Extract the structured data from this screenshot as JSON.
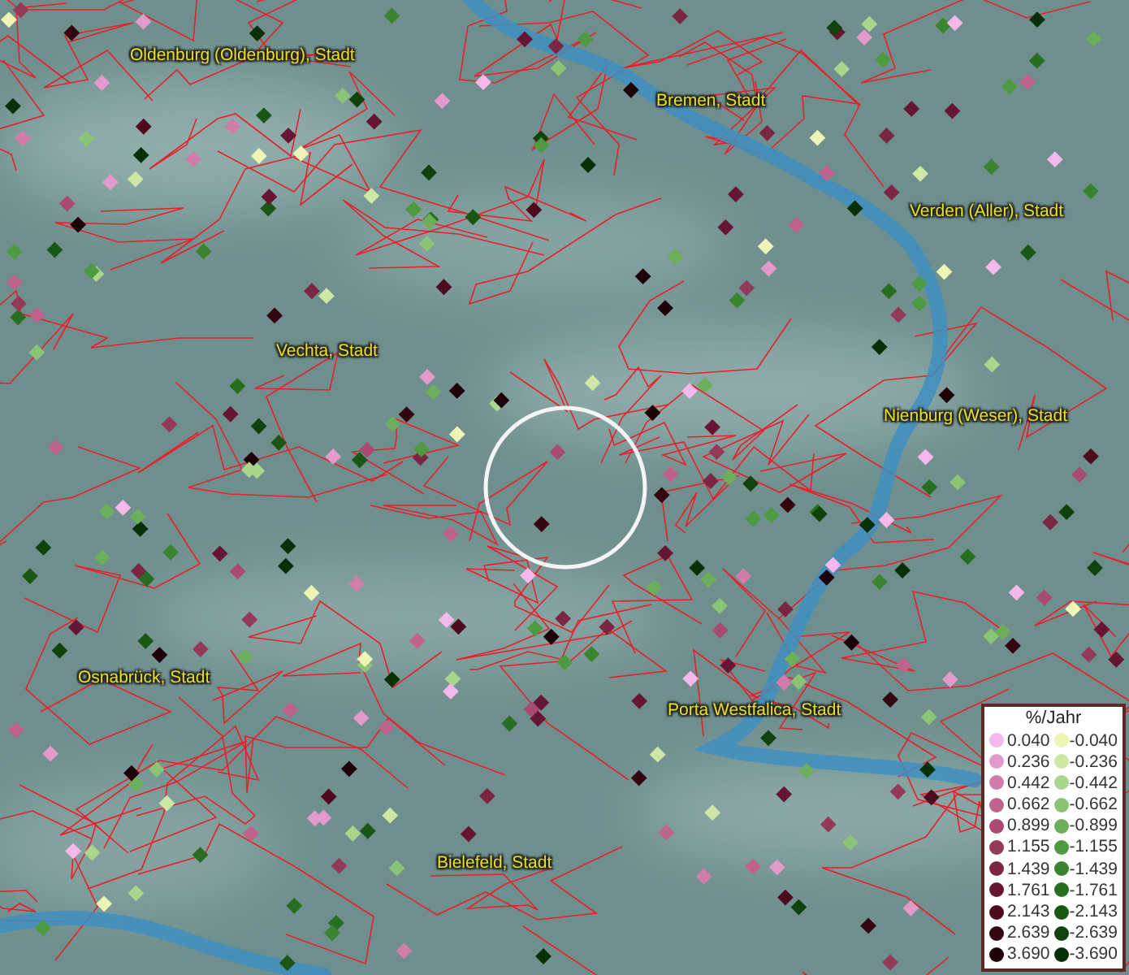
{
  "map": {
    "places": [
      {
        "name": "Oldenburg (Oldenburg), Stadt"
      },
      {
        "name": "Bremen, Stadt"
      },
      {
        "name": "Verden (Aller), Stadt"
      },
      {
        "name": "Vechta, Stadt"
      },
      {
        "name": "Nienburg (Weser), Stadt"
      },
      {
        "name": "Osnabrück, Stadt"
      },
      {
        "name": "Porta Westfalica, Stadt"
      },
      {
        "name": "Bielefeld, Stadt"
      }
    ]
  },
  "legend": {
    "title": "%/Jahr",
    "rows": [
      {
        "positive": {
          "label": "0.040",
          "color": "#f5b8ea"
        },
        "negative": {
          "label": "-0.040",
          "color": "#eef4b4"
        }
      },
      {
        "positive": {
          "label": "0.236",
          "color": "#e29acb"
        },
        "negative": {
          "label": "-0.236",
          "color": "#cce8a2"
        }
      },
      {
        "positive": {
          "label": "0.442",
          "color": "#d27da9"
        },
        "negative": {
          "label": "-0.442",
          "color": "#aad68c"
        }
      },
      {
        "positive": {
          "label": "0.662",
          "color": "#bf638c"
        },
        "negative": {
          "label": "-0.662",
          "color": "#8cc476"
        }
      },
      {
        "positive": {
          "label": "0.899",
          "color": "#a94a70"
        },
        "negative": {
          "label": "-0.899",
          "color": "#6cae5a"
        }
      },
      {
        "positive": {
          "label": "1.155",
          "color": "#933a58"
        },
        "negative": {
          "label": "-1.155",
          "color": "#4e9a40"
        }
      },
      {
        "positive": {
          "label": "1.439",
          "color": "#7b2642"
        },
        "negative": {
          "label": "-1.439",
          "color": "#3a8430"
        }
      },
      {
        "positive": {
          "label": "1.761",
          "color": "#661632"
        },
        "negative": {
          "label": "-1.761",
          "color": "#286e20"
        }
      },
      {
        "positive": {
          "label": "2.143",
          "color": "#4c0c1e"
        },
        "negative": {
          "label": "-2.143",
          "color": "#1a5614"
        }
      },
      {
        "positive": {
          "label": "2.639",
          "color": "#340612"
        },
        "negative": {
          "label": "-2.639",
          "color": "#10420c"
        }
      },
      {
        "positive": {
          "label": "3.690",
          "color": "#1e0008"
        },
        "negative": {
          "label": "-3.690",
          "color": "#083006"
        }
      }
    ]
  }
}
